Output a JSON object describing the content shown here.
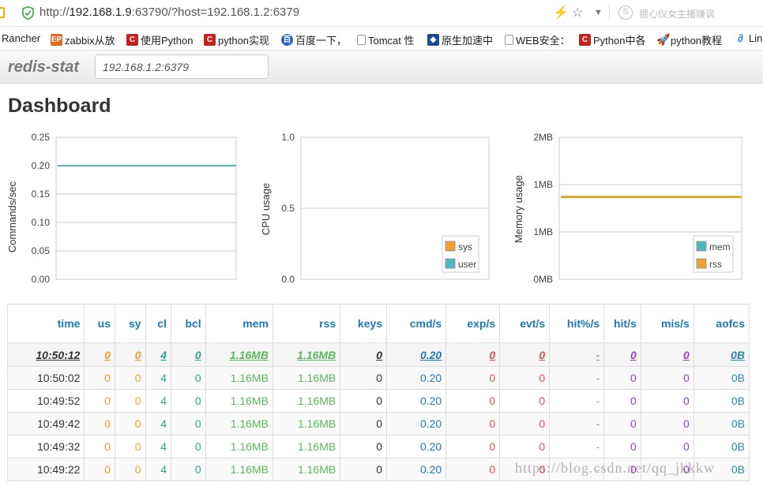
{
  "browser": {
    "url_prefix": "http://",
    "url_host": "192.168.1.9",
    "url_rest": ":63790/?host=192.168.1.2:6379",
    "search_badge": "S",
    "search_placeholder": "猥心仪女主播赚讽",
    "icons": [
      "bolt-icon",
      "star-icon",
      "chevron-down-icon"
    ]
  },
  "bookmarks": [
    {
      "label": "Rancher",
      "icon": "",
      "kind": "none"
    },
    {
      "label": "zabbix从放",
      "icon": "EP",
      "kind": "orange"
    },
    {
      "label": "使用Python",
      "icon": "C",
      "kind": "red"
    },
    {
      "label": "python实现",
      "icon": "C",
      "kind": "red"
    },
    {
      "label": "百度一下，",
      "icon": "百",
      "kind": "blue"
    },
    {
      "label": "Tomcat 性",
      "icon": "",
      "kind": "page"
    },
    {
      "label": "原生加速中",
      "icon": "◆",
      "kind": "navy"
    },
    {
      "label": "WEB安全：",
      "icon": "",
      "kind": "page"
    },
    {
      "label": "Python中各",
      "icon": "C",
      "kind": "red"
    },
    {
      "label": "python教程",
      "icon": "🚀",
      "kind": "rocket"
    },
    {
      "label": "Linu",
      "icon": "∂",
      "kind": "rocket"
    }
  ],
  "app": {
    "brand": "redis-stat",
    "host_value": "192.168.1.2:6379",
    "page_title": "Dashboard"
  },
  "charts": {
    "commands": {
      "ylabel": "Commands/sec",
      "ticks": [
        "0.25",
        "0.20",
        "0.15",
        "0.10",
        "0.05",
        "0.00"
      ],
      "series_color": "#4db8c3"
    },
    "cpu": {
      "ylabel": "CPU usage",
      "ticks": [
        "1.0",
        "0.5",
        "0.0"
      ],
      "legend": [
        {
          "name": "sys",
          "color": "#f0a030"
        },
        {
          "name": "user",
          "color": "#4db8c3"
        }
      ]
    },
    "memory": {
      "ylabel": "Memory usage",
      "ticks": [
        "2MB",
        "1MB",
        "1MB",
        "0MB"
      ],
      "legend": [
        {
          "name": "mem",
          "color": "#4db8c3"
        },
        {
          "name": "rss",
          "color": "#f0a030"
        }
      ],
      "series_color": "#e0a833"
    }
  },
  "chart_data": [
    {
      "type": "line",
      "ylabel": "Commands/sec",
      "ylim": [
        0,
        0.25
      ],
      "series": [
        {
          "values": [
            0.2,
            0.2,
            0.2,
            0.2,
            0.2,
            0.2
          ]
        }
      ],
      "grid": true
    },
    {
      "type": "area",
      "ylabel": "CPU usage",
      "ylim": [
        0,
        1.0
      ],
      "series": [
        {
          "name": "sys",
          "values": [
            0,
            0,
            0,
            0,
            0,
            0
          ]
        },
        {
          "name": "user",
          "values": [
            0,
            0,
            0,
            0,
            0,
            0
          ]
        }
      ],
      "legend": "bottom-right"
    },
    {
      "type": "line",
      "ylabel": "Memory usage",
      "ylim": [
        0,
        2
      ],
      "series": [
        {
          "name": "mem",
          "values": [
            1.16,
            1.16,
            1.16,
            1.16,
            1.16,
            1.16
          ]
        },
        {
          "name": "rss",
          "values": [
            1.16,
            1.16,
            1.16,
            1.16,
            1.16,
            1.16
          ]
        }
      ],
      "legend": "bottom-right"
    }
  ],
  "table": {
    "headers": [
      "time",
      "us",
      "sy",
      "cl",
      "bcl",
      "mem",
      "rss",
      "keys",
      "cmd/s",
      "exp/s",
      "evt/s",
      "hit%/s",
      "hit/s",
      "mis/s",
      "aofcs"
    ],
    "rows": [
      [
        "10:50:12",
        "0",
        "0",
        "4",
        "0",
        "1.16MB",
        "1.16MB",
        "0",
        "0.20",
        "0",
        "0",
        "-",
        "0",
        "0",
        "0B"
      ],
      [
        "10:50:02",
        "0",
        "0",
        "4",
        "0",
        "1.16MB",
        "1.16MB",
        "0",
        "0.20",
        "0",
        "0",
        "-",
        "0",
        "0",
        "0B"
      ],
      [
        "10:49:52",
        "0",
        "0",
        "4",
        "0",
        "1.16MB",
        "1.16MB",
        "0",
        "0.20",
        "0",
        "0",
        "-",
        "0",
        "0",
        "0B"
      ],
      [
        "10:49:42",
        "0",
        "0",
        "4",
        "0",
        "1.16MB",
        "1.16MB",
        "0",
        "0.20",
        "0",
        "0",
        "-",
        "0",
        "0",
        "0B"
      ],
      [
        "10:49:32",
        "0",
        "0",
        "4",
        "0",
        "1.16MB",
        "1.16MB",
        "0",
        "0.20",
        "0",
        "0",
        "-",
        "0",
        "0",
        "0B"
      ],
      [
        "10:49:22",
        "0",
        "0",
        "4",
        "0",
        "1.16MB",
        "1.16MB",
        "0",
        "0.20",
        "0",
        "0",
        "-",
        "0",
        "0",
        "0B"
      ]
    ]
  },
  "watermark": "https://blog.csdn.net/qq_jkkkw"
}
